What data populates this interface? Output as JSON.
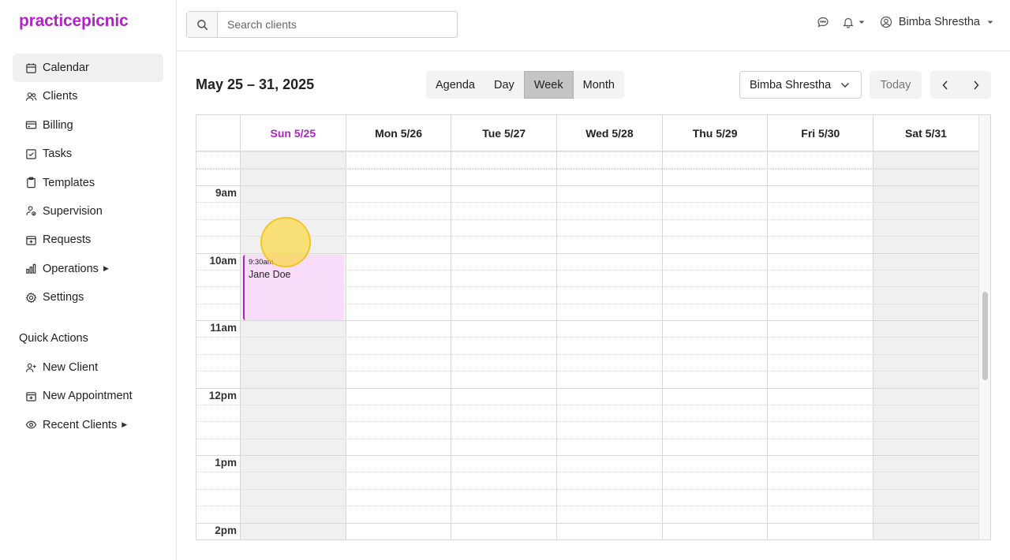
{
  "app": {
    "logo": "practicepicnic",
    "brand_color": "#b321c9"
  },
  "sidebar": {
    "items": [
      {
        "label": "Calendar",
        "icon": "calendar-icon",
        "active": true
      },
      {
        "label": "Clients",
        "icon": "users-icon"
      },
      {
        "label": "Billing",
        "icon": "credit-card-icon"
      },
      {
        "label": "Tasks",
        "icon": "checkbox-icon"
      },
      {
        "label": "Templates",
        "icon": "clipboard-icon"
      },
      {
        "label": "Supervision",
        "icon": "supervision-icon"
      },
      {
        "label": "Requests",
        "icon": "calendar-plus-icon"
      },
      {
        "label": "Operations",
        "icon": "bar-chart-icon",
        "has_submenu": true
      },
      {
        "label": "Settings",
        "icon": "gear-icon"
      }
    ],
    "quick_actions_title": "Quick Actions",
    "quick_actions": [
      {
        "label": "New Client",
        "icon": "user-plus-icon"
      },
      {
        "label": "New Appointment",
        "icon": "calendar-plus-icon"
      },
      {
        "label": "Recent Clients",
        "icon": "eye-icon",
        "has_submenu": true
      }
    ]
  },
  "topbar": {
    "search_placeholder": "Search clients",
    "user_name": "Bimba Shrestha"
  },
  "calendar": {
    "range_title": "May 25 – 31, 2025",
    "views": [
      "Agenda",
      "Day",
      "Week",
      "Month"
    ],
    "active_view": "Week",
    "provider": "Bimba Shrestha",
    "today_label": "Today",
    "days": [
      "Sun 5/25",
      "Mon 5/26",
      "Tue 5/27",
      "Wed 5/28",
      "Thu 5/29",
      "Fri 5/30",
      "Sat 5/31"
    ],
    "today_index": 0,
    "time_labels": [
      "9am",
      "10am",
      "11am",
      "12pm",
      "1pm",
      "2pm"
    ],
    "appointment": {
      "time": "9:30am",
      "client": "Jane Doe",
      "color": "#f8dcf9",
      "accent": "#a622b8"
    }
  }
}
